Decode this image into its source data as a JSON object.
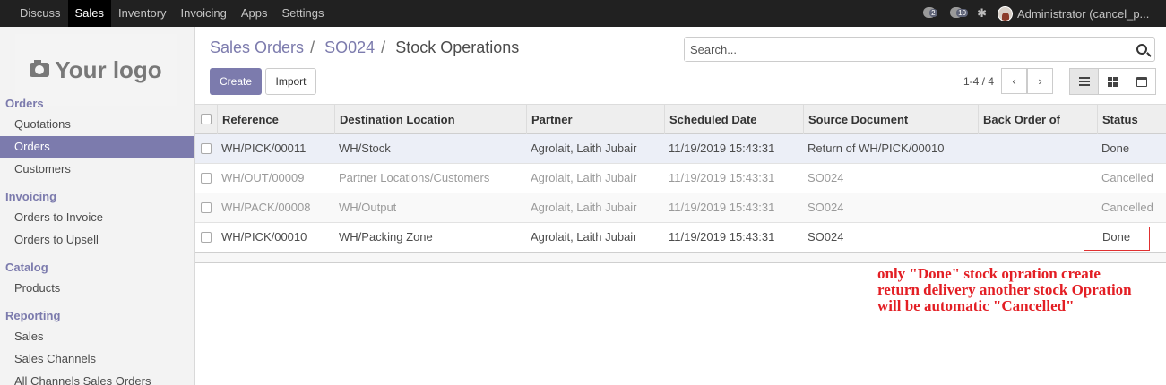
{
  "topbar": {
    "menu": [
      "Discuss",
      "Sales",
      "Inventory",
      "Invoicing",
      "Apps",
      "Settings"
    ],
    "active_menu": "Sales",
    "chat_count": "2",
    "messages_count": "10",
    "user_name": "Administrator (cancel_p..."
  },
  "sidebar": {
    "logo_text": "Your logo",
    "sections": [
      {
        "title": "Orders",
        "items": [
          "Quotations",
          "Orders",
          "Customers"
        ]
      },
      {
        "title": "Invoicing",
        "items": [
          "Orders to Invoice",
          "Orders to Upsell"
        ]
      },
      {
        "title": "Catalog",
        "items": [
          "Products"
        ]
      },
      {
        "title": "Reporting",
        "items": [
          "Sales",
          "Sales Channels",
          "All Channels Sales Orders"
        ]
      }
    ],
    "active_item": "Orders"
  },
  "breadcrumb": {
    "level1": "Sales Orders",
    "level2": "SO024",
    "current": "Stock Operations",
    "separator": "/"
  },
  "toolbar": {
    "create_label": "Create",
    "import_label": "Import"
  },
  "search": {
    "placeholder": "Search..."
  },
  "pager": {
    "value": "1-4 / 4",
    "prev": "‹",
    "next": "›"
  },
  "views": [
    "list",
    "kanban",
    "calendar"
  ],
  "active_view": "list",
  "table": {
    "columns": [
      "Reference",
      "Destination Location",
      "Partner",
      "Scheduled Date",
      "Source Document",
      "Back Order of",
      "Status"
    ],
    "rows": [
      [
        "WH/PICK/00011",
        "WH/Stock",
        "Agrolait, Laith Jubair",
        "11/19/2019 15:43:31",
        "Return of WH/PICK/00010",
        "",
        "Done"
      ],
      [
        "WH/OUT/00009",
        "Partner Locations/Customers",
        "Agrolait, Laith Jubair",
        "11/19/2019 15:43:31",
        "SO024",
        "",
        "Cancelled"
      ],
      [
        "WH/PACK/00008",
        "WH/Output",
        "Agrolait, Laith Jubair",
        "11/19/2019 15:43:31",
        "SO024",
        "",
        "Cancelled"
      ],
      [
        "WH/PICK/00010",
        "WH/Packing Zone",
        "Agrolait, Laith Jubair",
        "11/19/2019 15:43:31",
        "SO024",
        "",
        "Done"
      ]
    ]
  },
  "annotation": {
    "lines": [
      "only \"Done\" stock opration create",
      "return delivery another stock Opration",
      "will be automatic \"Cancelled\""
    ],
    "color": "#e31e24"
  },
  "colors": {
    "brand": "#7c7bad",
    "topbar": "#212121",
    "highlight": "#e03030"
  }
}
